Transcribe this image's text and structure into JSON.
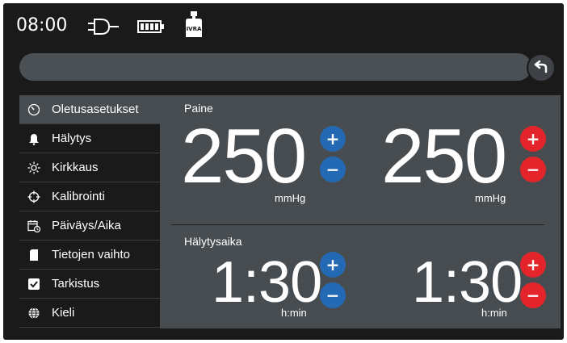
{
  "status": {
    "time": "08:00",
    "icons": [
      "plug-icon",
      "battery-icon",
      "device-icon"
    ],
    "device_label": "IVRA"
  },
  "sidebar": {
    "items": [
      {
        "label": "Oletusasetukset",
        "icon": "gauge-icon",
        "active": true
      },
      {
        "label": "Hälytys",
        "icon": "bell-icon",
        "active": false
      },
      {
        "label": "Kirkkaus",
        "icon": "sun-icon",
        "active": false
      },
      {
        "label": "Kalibrointi",
        "icon": "crosshair-icon",
        "active": false
      },
      {
        "label": "Päiväys/Aika",
        "icon": "calendar-clock-icon",
        "active": false
      },
      {
        "label": "Tietojen vaihto",
        "icon": "sd-card-icon",
        "active": false
      },
      {
        "label": "Tarkistus",
        "icon": "checkbox-icon",
        "active": false
      },
      {
        "label": "Kieli",
        "icon": "globe-icon",
        "active": false
      }
    ]
  },
  "main": {
    "pressure": {
      "title": "Paine",
      "left_value": "250",
      "right_value": "250",
      "unit": "mmHg"
    },
    "alarm_time": {
      "title": "Hälytysaika",
      "left_value": "1:30",
      "right_value": "1:30",
      "unit": "h:min"
    },
    "plus_label": "+",
    "minus_label": "−"
  },
  "colors": {
    "background": "#1a1a1a",
    "panel": "#474c50",
    "blue_button": "#2469b3",
    "red_button": "#e3252b"
  }
}
